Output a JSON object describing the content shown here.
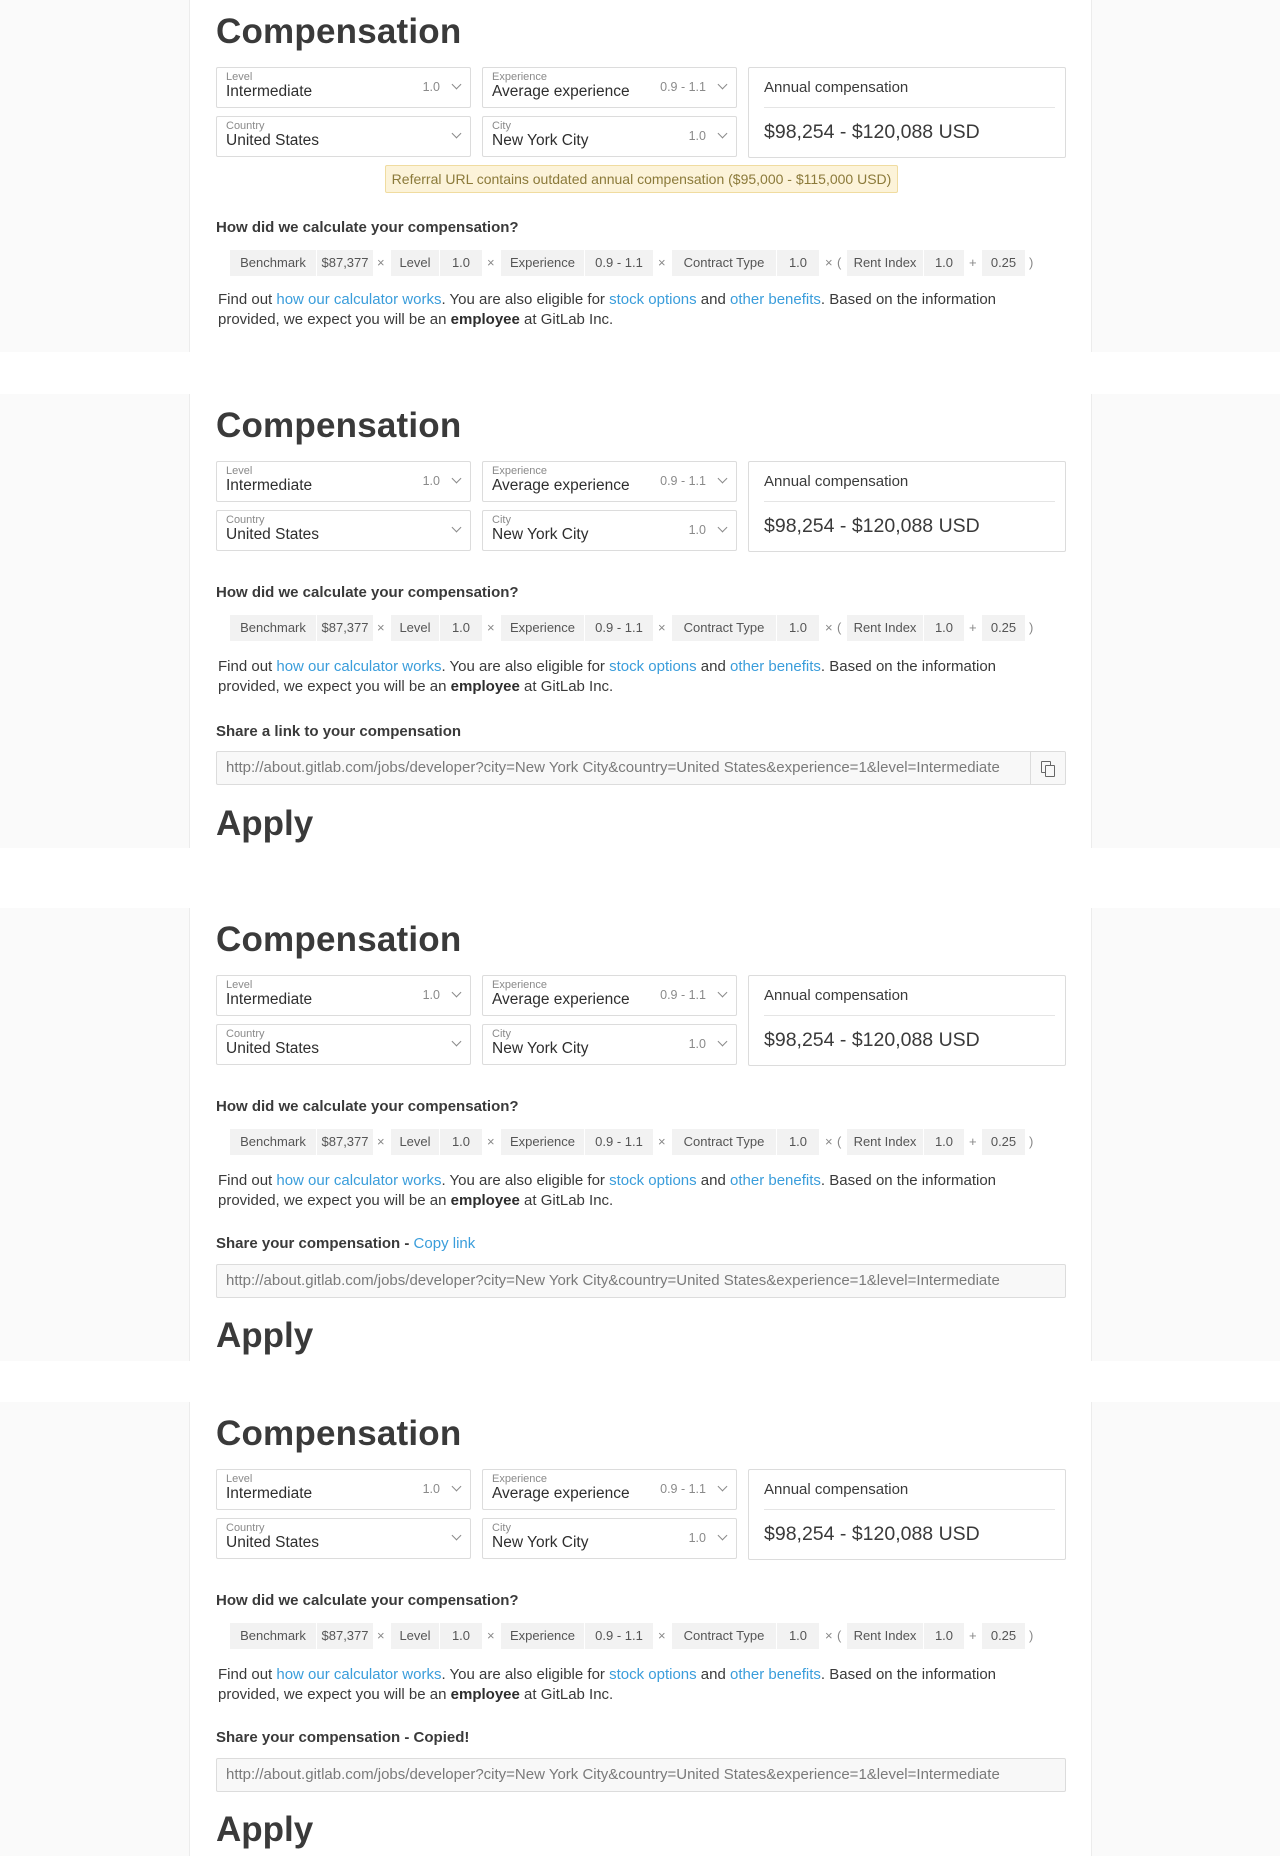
{
  "compensation": {
    "title": "Compensation",
    "level": {
      "label": "Level",
      "value": "Intermediate",
      "multiplier": "1.0"
    },
    "experience": {
      "label": "Experience",
      "value": "Average experience",
      "multiplier": "0.9 - 1.1"
    },
    "country": {
      "label": "Country",
      "value": "United States"
    },
    "city": {
      "label": "City",
      "value": "New York City",
      "multiplier": "1.0"
    },
    "annual": {
      "label": "Annual compensation",
      "value": "$98,254 - $120,088 USD"
    },
    "warning": "Referral URL contains outdated annual compensation ($95,000 - $115,000 USD)",
    "calc_question": "How did we calculate your compensation?",
    "formula": {
      "benchmark_label": "Benchmark",
      "benchmark_value": "$87,377",
      "level_label": "Level",
      "level_value": "1.0",
      "experience_label": "Experience",
      "experience_value": "0.9 - 1.1",
      "contract_label": "Contract Type",
      "contract_value": "1.0",
      "rent_label": "Rent Index",
      "rent_value": "1.0",
      "plus_value": "0.25",
      "times": "×",
      "plus": "+",
      "open_paren": "(",
      "close_paren": ")"
    },
    "description": {
      "p1": "Find out ",
      "link1": "how our calculator works",
      "p2": ". You are also eligible for ",
      "link2": "stock options",
      "p3": " and ",
      "link3": "other benefits",
      "p4": ". Based on the information provided, we expect you will be an ",
      "bold": "employee",
      "p5": " at GitLab Inc."
    },
    "share_url": "http://about.gitlab.com/jobs/developer?city=New York City&country=United States&experience=1&level=Intermediate",
    "apply": "Apply"
  },
  "variants": {
    "v2_share_label": "Share a link to your compensation",
    "v3_share_label": "Share your compensation - ",
    "v3_copy_link": "Copy link",
    "v4_share_label": "Share your compensation - Copied!"
  }
}
